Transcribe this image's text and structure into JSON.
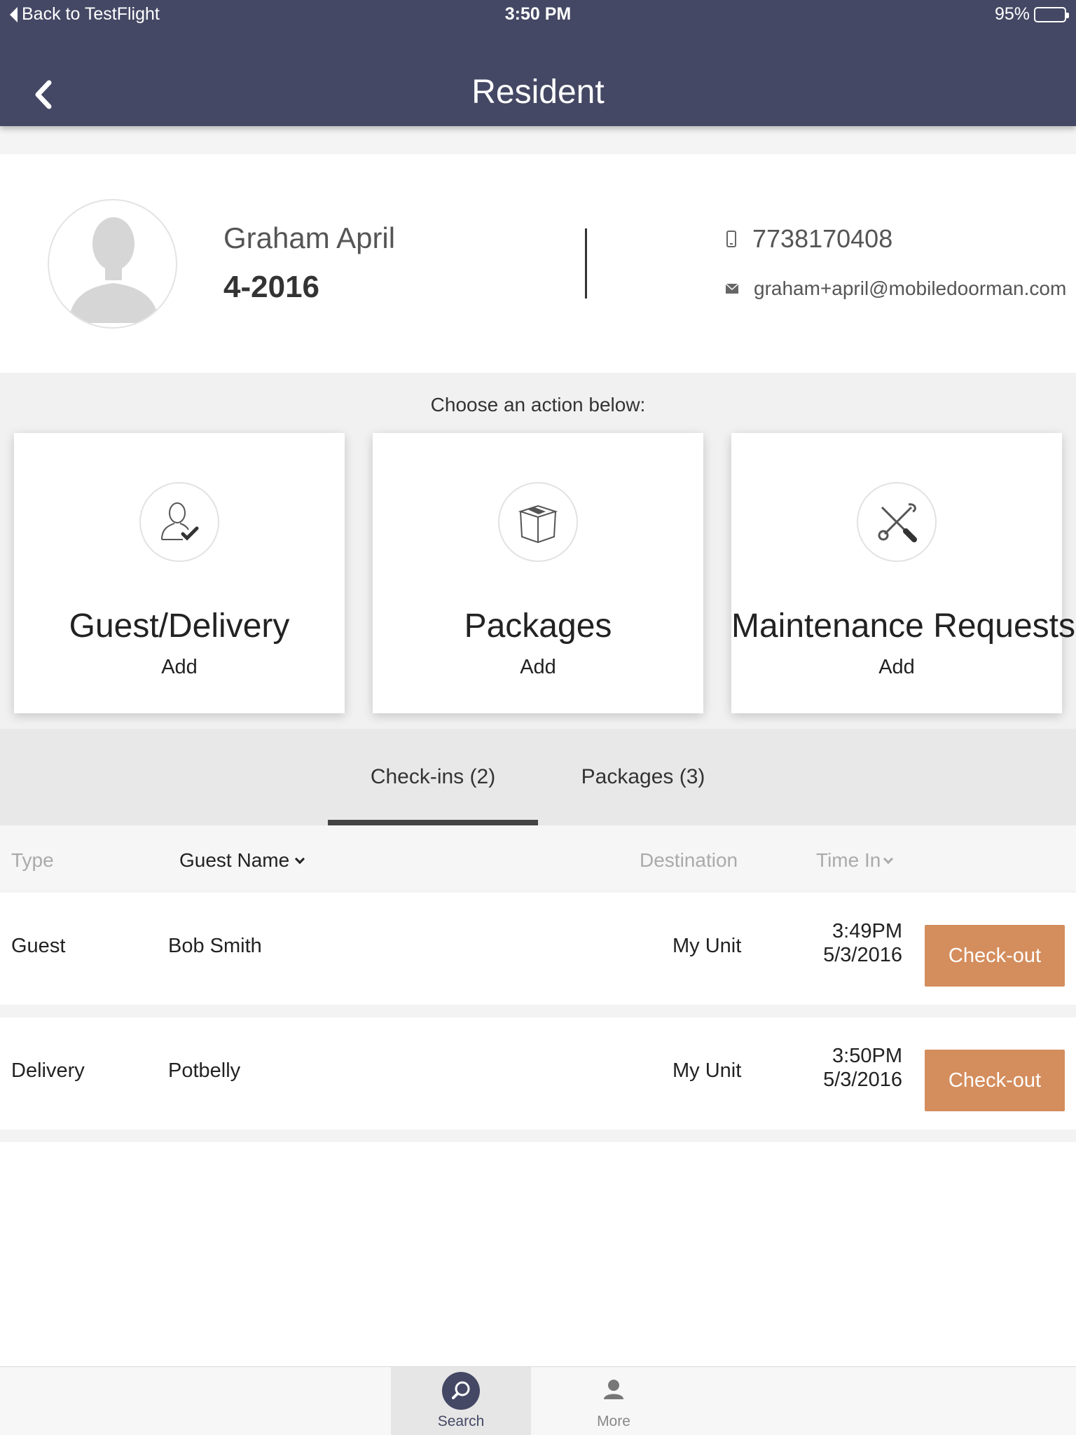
{
  "status_bar": {
    "back_label": "Back to TestFlight",
    "time": "3:50 PM",
    "battery": "95%"
  },
  "header": {
    "title": "Resident"
  },
  "resident": {
    "name": "Graham April",
    "unit": "4-2016",
    "phone": "7738170408",
    "email": "graham+april@mobiledoorman.com"
  },
  "actions": {
    "prompt": "Choose an action below:",
    "cards": [
      {
        "title": "Guest/Delivery",
        "sub": "Add",
        "icon": "guest-check-icon"
      },
      {
        "title": "Packages",
        "sub": "Add",
        "icon": "package-box-icon"
      },
      {
        "title": "Maintenance Requests",
        "sub": "Add",
        "icon": "tools-icon"
      }
    ]
  },
  "tabs": [
    {
      "label": "Check-ins (2)",
      "active": true
    },
    {
      "label": "Packages (3)",
      "active": false
    }
  ],
  "table": {
    "columns": {
      "type": "Type",
      "guest_name": "Guest Name",
      "destination": "Destination",
      "time_in": "Time In"
    },
    "rows": [
      {
        "type": "Guest",
        "guest_name": "Bob Smith",
        "destination": "My Unit",
        "time": "3:49PM",
        "date": "5/3/2016",
        "action": "Check-out"
      },
      {
        "type": "Delivery",
        "guest_name": "Potbelly",
        "destination": "My Unit",
        "time": "3:50PM",
        "date": "5/3/2016",
        "action": "Check-out"
      }
    ]
  },
  "tabbar": [
    {
      "label": "Search",
      "icon": "search-icon",
      "active": true
    },
    {
      "label": "More",
      "icon": "person-icon",
      "active": false
    }
  ],
  "colors": {
    "header": "#444864",
    "checkout": "#d48d5c",
    "tab_indicator": "#444444"
  }
}
